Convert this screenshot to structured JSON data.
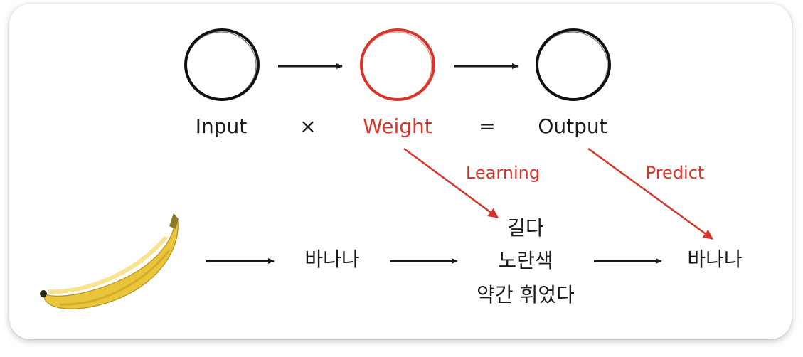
{
  "colors": {
    "accent": "#d8352a",
    "ink": "#1a1a1a"
  },
  "formula": {
    "input": "Input",
    "times": "×",
    "weight": "Weight",
    "equals": "=",
    "output": "Output"
  },
  "annotations": {
    "learning": "Learning",
    "predict": "Predict"
  },
  "pipeline": {
    "input_label": "바나나",
    "features": [
      "길다",
      "노란색",
      "약간 휘었다"
    ],
    "output_label": "바나나"
  },
  "icons": {
    "banana": "banana-icon",
    "circles": "brush-circle-icon"
  }
}
